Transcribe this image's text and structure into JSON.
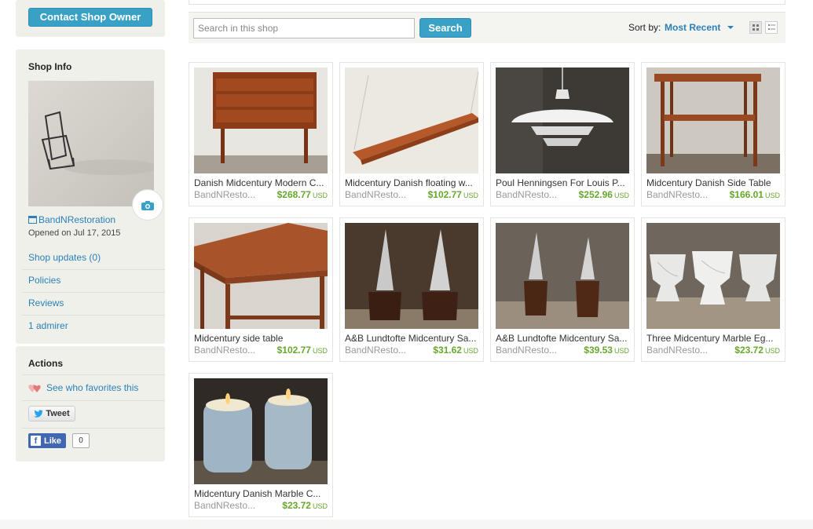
{
  "sidebar": {
    "contact_label": "Contact Shop Owner",
    "shop_info_title": "Shop Info",
    "shop_name": "BandNRestoration",
    "opened": "Opened on Jul 17, 2015",
    "links": [
      "Shop updates (0)",
      "Policies",
      "Reviews",
      "1 admirer"
    ],
    "actions_title": "Actions",
    "favorites_label": "See who favorites this",
    "tweet_label": "Tweet",
    "like_label": "Like",
    "like_count": "0"
  },
  "search": {
    "placeholder": "Search in this shop",
    "button_label": "Search",
    "sort_label": "Sort by:",
    "sort_value": "Most Recent"
  },
  "listings": [
    {
      "title": "Danish Midcentury Modern C...",
      "seller": "BandNResto...",
      "price": "$268.77",
      "currency": "USD"
    },
    {
      "title": "Midcentury Danish floating w...",
      "seller": "BandNResto...",
      "price": "$102.77",
      "currency": "USD"
    },
    {
      "title": "Poul Henningsen For Louis P...",
      "seller": "BandNResto...",
      "price": "$252.96",
      "currency": "USD"
    },
    {
      "title": "Midcentury Danish Side Table",
      "seller": "BandNResto...",
      "price": "$166.01",
      "currency": "USD"
    },
    {
      "title": "Midcentury side table",
      "seller": "BandNResto...",
      "price": "$102.77",
      "currency": "USD"
    },
    {
      "title": "A&B Lundtofte Midcentury Sa...",
      "seller": "BandNResto...",
      "price": "$31.62",
      "currency": "USD"
    },
    {
      "title": "A&B Lundtofte Midcentury Sa...",
      "seller": "BandNResto...",
      "price": "$39.53",
      "currency": "USD"
    },
    {
      "title": "Three Midcentury Marble Eg...",
      "seller": "BandNResto...",
      "price": "$23.72",
      "currency": "USD"
    },
    {
      "title": "Midcentury Danish Marble C...",
      "seller": "BandNResto...",
      "price": "$23.72",
      "currency": "USD"
    }
  ],
  "colors": {
    "accent": "#3aa1c6",
    "link": "#2a80b9",
    "price": "#67a82d",
    "sidebar_bg": "#f0f0ea"
  }
}
